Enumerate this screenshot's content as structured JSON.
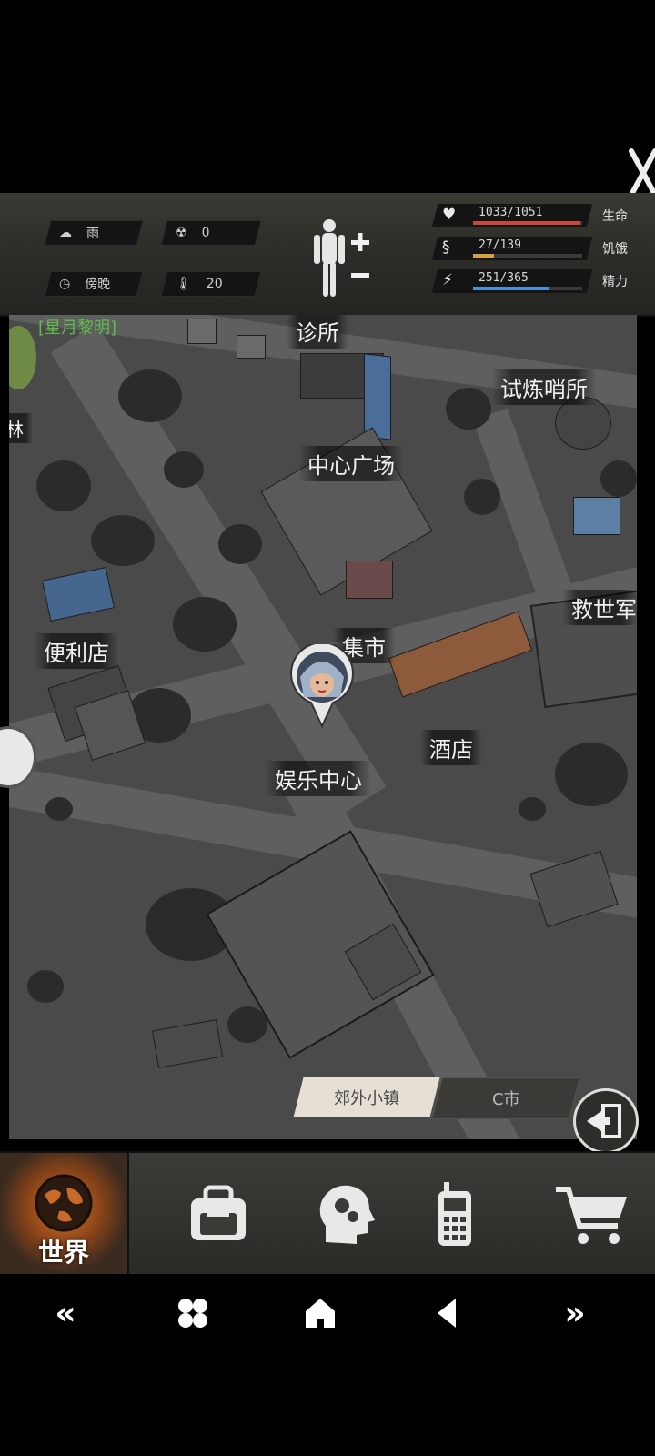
{
  "hud": {
    "weather": "雨",
    "radiation": "0",
    "time_of_day": "傍晚",
    "temperature": "20",
    "stats": [
      {
        "icon": "heart-icon",
        "value": "1033/1051",
        "label": "生命",
        "fraction": 0.983,
        "color": "#c8473a"
      },
      {
        "icon": "stomach-icon",
        "value": "27/139",
        "label": "饥饿",
        "fraction": 0.194,
        "color": "#d0a540"
      },
      {
        "icon": "energy-icon",
        "value": "251/365",
        "label": "精力",
        "fraction": 0.688,
        "color": "#4d8fd6"
      }
    ]
  },
  "map": {
    "labels": {
      "top_left": "[星月黎明]",
      "clinic": "诊所",
      "trial_post": "试炼哨所",
      "forest": "林",
      "central_square": "中心广场",
      "rescue_army": "救世军",
      "convenience_store": "便利店",
      "market": "集市",
      "hotel": "酒店",
      "entertainment_center": "娱乐中心"
    }
  },
  "region_tabs": {
    "active": "郊外小镇",
    "other": "C市"
  },
  "nav": {
    "world_label": "世界",
    "items": [
      "backpack-icon",
      "brain-icon",
      "radio-icon",
      "cart-icon"
    ]
  },
  "colors": {
    "health": "#c8473a",
    "hunger": "#d0a540",
    "energy": "#4d8fd6",
    "label_green": "#5fbd4c",
    "world_glow": "#d2742a"
  }
}
